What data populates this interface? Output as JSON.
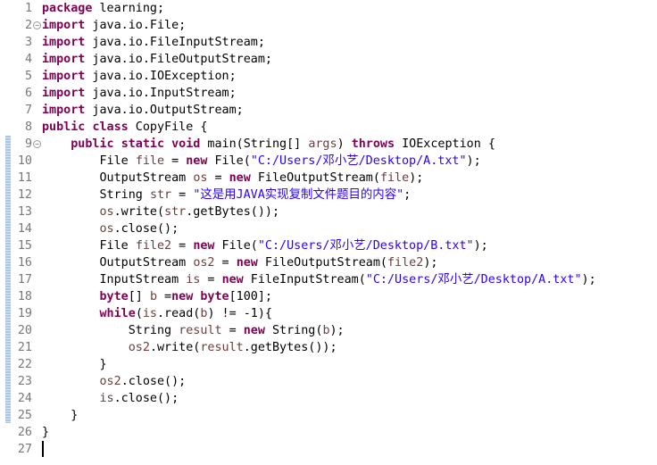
{
  "editor": {
    "lines": [
      {
        "num": "1",
        "code": [
          {
            "t": "package",
            "c": "k"
          },
          {
            "t": " learning;"
          }
        ]
      },
      {
        "num": "2",
        "fold": "−",
        "code": [
          {
            "t": "import",
            "c": "k"
          },
          {
            "t": " java.io.File;"
          }
        ]
      },
      {
        "num": "3",
        "code": [
          {
            "t": "import",
            "c": "k"
          },
          {
            "t": " java.io.FileInputStream;"
          }
        ]
      },
      {
        "num": "4",
        "code": [
          {
            "t": "import",
            "c": "k"
          },
          {
            "t": " java.io.FileOutputStream;"
          }
        ]
      },
      {
        "num": "5",
        "code": [
          {
            "t": "import",
            "c": "k"
          },
          {
            "t": " java.io.IOException;"
          }
        ]
      },
      {
        "num": "6",
        "code": [
          {
            "t": "import",
            "c": "k"
          },
          {
            "t": " java.io.InputStream;"
          }
        ]
      },
      {
        "num": "7",
        "code": [
          {
            "t": "import",
            "c": "k"
          },
          {
            "t": " java.io.OutputStream;"
          }
        ]
      },
      {
        "num": "8",
        "code": [
          {
            "t": "public",
            "c": "k"
          },
          {
            "t": " "
          },
          {
            "t": "class",
            "c": "k"
          },
          {
            "t": " CopyFile {"
          }
        ]
      },
      {
        "num": "9",
        "fold": "−",
        "code": [
          {
            "t": "    "
          },
          {
            "t": "public",
            "c": "k"
          },
          {
            "t": " "
          },
          {
            "t": "static",
            "c": "k"
          },
          {
            "t": " "
          },
          {
            "t": "void",
            "c": "k"
          },
          {
            "t": " main(String[] "
          },
          {
            "t": "args",
            "c": "v"
          },
          {
            "t": ") "
          },
          {
            "t": "throws",
            "c": "k"
          },
          {
            "t": " IOException {"
          }
        ]
      },
      {
        "num": "10",
        "code": [
          {
            "t": "        File "
          },
          {
            "t": "file",
            "c": "v"
          },
          {
            "t": " = "
          },
          {
            "t": "new",
            "c": "k"
          },
          {
            "t": " File("
          },
          {
            "t": "\"C:/Users/邓小艺/Desktop/A.txt\"",
            "c": "s"
          },
          {
            "t": ");"
          }
        ]
      },
      {
        "num": "11",
        "code": [
          {
            "t": "        OutputStream "
          },
          {
            "t": "os",
            "c": "v"
          },
          {
            "t": " = "
          },
          {
            "t": "new",
            "c": "k"
          },
          {
            "t": " FileOutputStream("
          },
          {
            "t": "file",
            "c": "v"
          },
          {
            "t": ");"
          }
        ]
      },
      {
        "num": "12",
        "code": [
          {
            "t": "        String "
          },
          {
            "t": "str",
            "c": "v"
          },
          {
            "t": " = "
          },
          {
            "t": "\"这是用JAVA实现复制文件题目的内容\"",
            "c": "s"
          },
          {
            "t": ";"
          }
        ]
      },
      {
        "num": "13",
        "code": [
          {
            "t": "        "
          },
          {
            "t": "os",
            "c": "v"
          },
          {
            "t": ".write("
          },
          {
            "t": "str",
            "c": "v"
          },
          {
            "t": ".getBytes());"
          }
        ]
      },
      {
        "num": "14",
        "code": [
          {
            "t": "        "
          },
          {
            "t": "os",
            "c": "v"
          },
          {
            "t": ".close();"
          }
        ]
      },
      {
        "num": "15",
        "code": [
          {
            "t": "        File "
          },
          {
            "t": "file2",
            "c": "v"
          },
          {
            "t": " = "
          },
          {
            "t": "new",
            "c": "k"
          },
          {
            "t": " File("
          },
          {
            "t": "\"C:/Users/邓小艺/Desktop/B.txt\"",
            "c": "s"
          },
          {
            "t": ");"
          }
        ]
      },
      {
        "num": "16",
        "code": [
          {
            "t": "        OutputStream "
          },
          {
            "t": "os2",
            "c": "v"
          },
          {
            "t": " = "
          },
          {
            "t": "new",
            "c": "k"
          },
          {
            "t": " FileOutputStream("
          },
          {
            "t": "file2",
            "c": "v"
          },
          {
            "t": ");"
          }
        ]
      },
      {
        "num": "17",
        "code": [
          {
            "t": "        InputStream "
          },
          {
            "t": "is",
            "c": "v"
          },
          {
            "t": " = "
          },
          {
            "t": "new",
            "c": "k"
          },
          {
            "t": " FileInputStream("
          },
          {
            "t": "\"C:/Users/邓小艺/Desktop/A.txt\"",
            "c": "s"
          },
          {
            "t": ");"
          }
        ]
      },
      {
        "num": "18",
        "code": [
          {
            "t": "        "
          },
          {
            "t": "byte",
            "c": "k"
          },
          {
            "t": "[] "
          },
          {
            "t": "b",
            "c": "v"
          },
          {
            "t": " ="
          },
          {
            "t": "new",
            "c": "k"
          },
          {
            "t": " "
          },
          {
            "t": "byte",
            "c": "k"
          },
          {
            "t": "[100];"
          }
        ]
      },
      {
        "num": "19",
        "code": [
          {
            "t": "        "
          },
          {
            "t": "while",
            "c": "k"
          },
          {
            "t": "("
          },
          {
            "t": "is",
            "c": "v"
          },
          {
            "t": ".read("
          },
          {
            "t": "b",
            "c": "v"
          },
          {
            "t": ") != -1){"
          }
        ]
      },
      {
        "num": "20",
        "code": [
          {
            "t": "            String "
          },
          {
            "t": "result",
            "c": "v"
          },
          {
            "t": " = "
          },
          {
            "t": "new",
            "c": "k"
          },
          {
            "t": " String("
          },
          {
            "t": "b",
            "c": "v"
          },
          {
            "t": ");"
          }
        ]
      },
      {
        "num": "21",
        "code": [
          {
            "t": "            "
          },
          {
            "t": "os2",
            "c": "v"
          },
          {
            "t": ".write("
          },
          {
            "t": "result",
            "c": "v"
          },
          {
            "t": ".getBytes());"
          }
        ]
      },
      {
        "num": "22",
        "code": [
          {
            "t": "        }"
          }
        ]
      },
      {
        "num": "23",
        "code": [
          {
            "t": "        "
          },
          {
            "t": "os2",
            "c": "v"
          },
          {
            "t": ".close();"
          }
        ]
      },
      {
        "num": "24",
        "code": [
          {
            "t": "        "
          },
          {
            "t": "is",
            "c": "v"
          },
          {
            "t": ".close();"
          }
        ]
      },
      {
        "num": "25",
        "code": [
          {
            "t": "    }"
          }
        ]
      },
      {
        "num": "26",
        "code": [
          {
            "t": "}"
          }
        ]
      },
      {
        "num": "27",
        "code": []
      }
    ]
  }
}
